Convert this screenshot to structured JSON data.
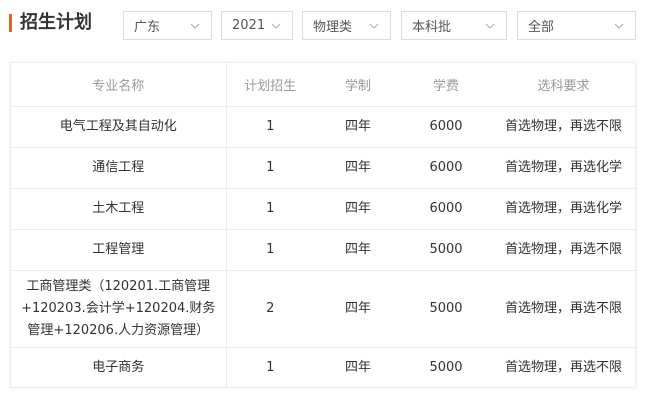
{
  "header": {
    "title": "招生计划",
    "accent_color": "#e8602c",
    "filters": [
      {
        "name": "province",
        "value": "广东"
      },
      {
        "name": "year",
        "value": "2021"
      },
      {
        "name": "subject-type",
        "value": "物理类"
      },
      {
        "name": "batch",
        "value": "本科批"
      },
      {
        "name": "scope",
        "value": "全部"
      }
    ],
    "chevron_icon": "chevron-down-icon"
  },
  "table": {
    "columns": [
      "专业名称",
      "计划招生",
      "学制",
      "学费",
      "选科要求"
    ],
    "rows": [
      {
        "major": "电气工程及其自动化",
        "plan": "1",
        "years": "四年",
        "fee": "6000",
        "req": "首选物理，再选不限"
      },
      {
        "major": "通信工程",
        "plan": "1",
        "years": "四年",
        "fee": "6000",
        "req": "首选物理，再选化学"
      },
      {
        "major": "土木工程",
        "plan": "1",
        "years": "四年",
        "fee": "6000",
        "req": "首选物理，再选化学"
      },
      {
        "major": "工程管理",
        "plan": "1",
        "years": "四年",
        "fee": "5000",
        "req": "首选物理，再选不限"
      },
      {
        "major": "工商管理类（120201.工商管理+120203.会计学+120204.财务管理+120206.人力资源管理）",
        "plan": "2",
        "years": "四年",
        "fee": "5000",
        "req": "首选物理，再选不限"
      },
      {
        "major": "电子商务",
        "plan": "1",
        "years": "四年",
        "fee": "5000",
        "req": "首选物理，再选不限"
      }
    ]
  }
}
